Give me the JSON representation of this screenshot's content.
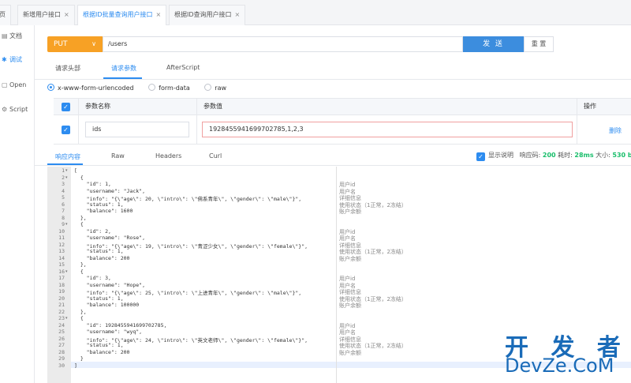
{
  "tabs": [
    {
      "label": "页",
      "active": false
    },
    {
      "label": "新增用户接口",
      "active": false
    },
    {
      "label": "根据ID批量查询用户接口",
      "active": true
    },
    {
      "label": "根据ID查询用户接口",
      "active": false
    }
  ],
  "tab_close": "×",
  "sidebar": {
    "items": [
      {
        "label": "文档",
        "icon": "document-icon"
      },
      {
        "label": "调试",
        "icon": "debug-icon",
        "active": true
      },
      {
        "label": "Open",
        "icon": "open-icon"
      },
      {
        "label": "Script",
        "icon": "script-icon"
      }
    ]
  },
  "request": {
    "method": "PUT",
    "url": "/users",
    "send_label": "发 送",
    "reset_label": "重 置",
    "tabs": [
      "请求头部",
      "请求参数",
      "AfterScript"
    ],
    "active_tab": "请求参数",
    "body_types": [
      "x-www-form-urlencoded",
      "form-data",
      "raw"
    ],
    "selected_body_type": "x-www-form-urlencoded",
    "param_table": {
      "headers": [
        "参数名称",
        "参数值",
        "操作"
      ],
      "rows": [
        {
          "name": "ids",
          "value": "1928455941699702785,1,2,3",
          "action": "删除"
        }
      ]
    }
  },
  "response": {
    "tabs": [
      "响应内容",
      "Raw",
      "Headers",
      "Curl"
    ],
    "active_tab": "响应内容",
    "show_desc_label": "显示说明",
    "status_label": "响应码:",
    "status_code": "200",
    "time_label": "耗时:",
    "time_value": "28ms",
    "size_label": "大小:",
    "size_value": "530 b",
    "line_numbers": [
      "1",
      "2",
      "3",
      "4",
      "5",
      "6",
      "7",
      "8",
      "9",
      "10",
      "11",
      "12",
      "13",
      "14",
      "15",
      "16",
      "17",
      "18",
      "19",
      "20",
      "21",
      "22",
      "23",
      "24",
      "25",
      "26",
      "27",
      "28",
      "29",
      "30"
    ],
    "code_lines": [
      "[",
      "  {",
      "    \"id\": 1,",
      "    \"username\": \"Jack\",",
      "    \"info\": \"{\\\"age\\\": 20, \\\"intro\\\": \\\"佛系青年\\\", \\\"gender\\\": \\\"male\\\"}\",",
      "    \"status\": 1,",
      "    \"balance\": 1600",
      "  },",
      "  {",
      "    \"id\": 2,",
      "    \"username\": \"Rose\",",
      "    \"info\": \"{\\\"age\\\": 19, \\\"intro\\\": \\\"青涩少女\\\", \\\"gender\\\": \\\"female\\\"}\",",
      "    \"status\": 1,",
      "    \"balance\": 200",
      "  },",
      "  {",
      "    \"id\": 3,",
      "    \"username\": \"Hope\",",
      "    \"info\": \"{\\\"age\\\": 25, \\\"intro\\\": \\\"上进青年\\\", \\\"gender\\\": \\\"male\\\"}\",",
      "    \"status\": 1,",
      "    \"balance\": 100000",
      "  },",
      "  {",
      "    \"id\": 1928455941699702785,",
      "    \"username\": \"wyq\",",
      "    \"info\": \"{\\\"age\\\": 24, \\\"intro\\\": \\\"英文老师\\\", \\\"gender\\\": \\\"female\\\"}\",",
      "    \"status\": 1,",
      "    \"balance\": 200",
      "  }",
      "]"
    ],
    "descriptions": [
      {
        "line": 3,
        "text": "用户id"
      },
      {
        "line": 4,
        "text": "用户名"
      },
      {
        "line": 5,
        "text": "详细信息"
      },
      {
        "line": 6,
        "text": "使用状态（1正常，2冻结）"
      },
      {
        "line": 7,
        "text": "账户余额"
      },
      {
        "line": 10,
        "text": "用户id"
      },
      {
        "line": 11,
        "text": "用户名"
      },
      {
        "line": 12,
        "text": "详细信息"
      },
      {
        "line": 13,
        "text": "使用状态（1正常，2冻结）"
      },
      {
        "line": 14,
        "text": "账户余额"
      },
      {
        "line": 17,
        "text": "用户id"
      },
      {
        "line": 18,
        "text": "用户名"
      },
      {
        "line": 19,
        "text": "详细信息"
      },
      {
        "line": 20,
        "text": "使用状态（1正常，2冻结）"
      },
      {
        "line": 21,
        "text": "账户余额"
      },
      {
        "line": 24,
        "text": "用户id"
      },
      {
        "line": 25,
        "text": "用户名"
      },
      {
        "line": 26,
        "text": "详细信息"
      },
      {
        "line": 27,
        "text": "使用状态（1正常，2冻结）"
      },
      {
        "line": 28,
        "text": "账户余额"
      }
    ],
    "fold_lines": [
      1,
      2,
      9,
      16,
      23
    ]
  },
  "watermark": {
    "top": "开 发 者",
    "bottom": "DevZe.CoM"
  }
}
